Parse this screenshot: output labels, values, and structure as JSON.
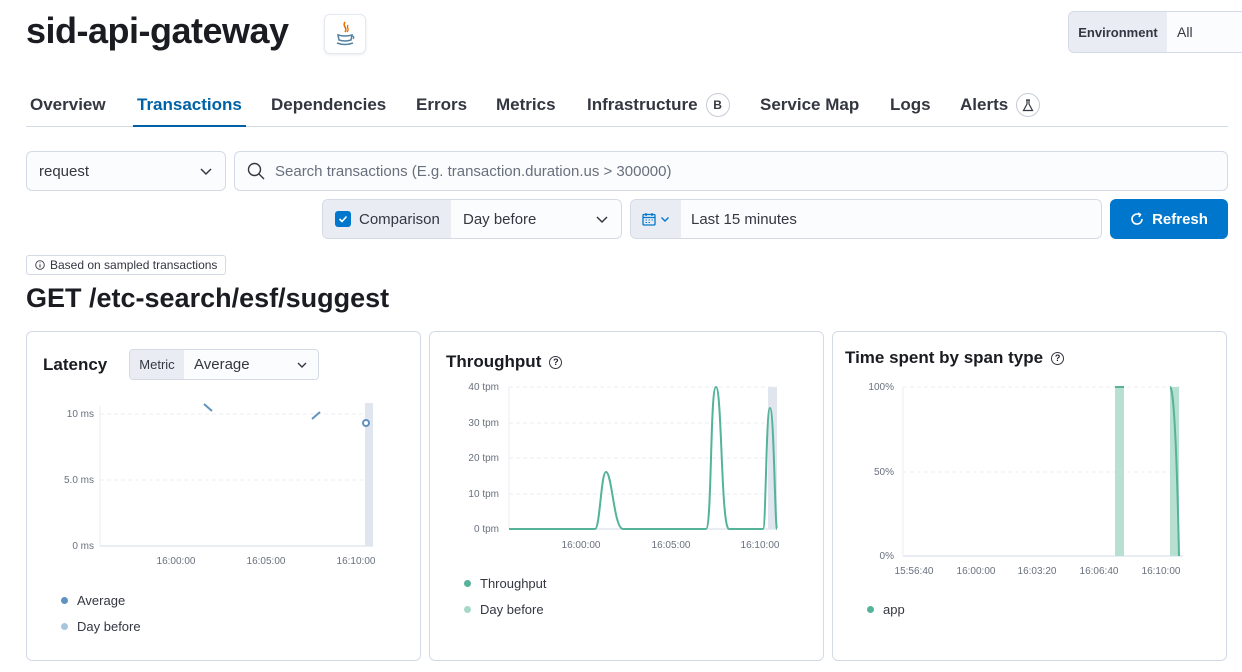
{
  "header": {
    "service_name": "sid-api-gateway",
    "agent_icon": "java-icon",
    "environment_label": "Environment",
    "environment_value": "All"
  },
  "tabs": [
    {
      "label": "Overview",
      "active": false
    },
    {
      "label": "Transactions",
      "active": true
    },
    {
      "label": "Dependencies",
      "active": false
    },
    {
      "label": "Errors",
      "active": false
    },
    {
      "label": "Metrics",
      "active": false
    },
    {
      "label": "Infrastructure",
      "active": false,
      "badge": "B"
    },
    {
      "label": "Service Map",
      "active": false
    },
    {
      "label": "Logs",
      "active": false
    },
    {
      "label": "Alerts",
      "active": false,
      "badge_icon": "flask-icon"
    }
  ],
  "filters": {
    "transaction_type": "request",
    "search_placeholder": "Search transactions (E.g. transaction.duration.us > 300000)",
    "comparison_label": "Comparison",
    "comparison_checked": true,
    "comparison_value": "Day before",
    "date_range": "Last 15 minutes",
    "refresh_label": "Refresh"
  },
  "sampled_badge": "Based on sampled transactions",
  "transaction_name": "GET /etc-search/esf/suggest",
  "colors": {
    "accent": "#0077cc",
    "latency_avg": "#6092c0",
    "latency_daybefore": "#a8c5e0",
    "throughput": "#54b399",
    "throughput_daybefore": "#a6d8c6",
    "app": "#54b399"
  },
  "panels": {
    "latency": {
      "title": "Latency",
      "metric_label": "Metric",
      "metric_value": "Average",
      "legend": [
        "Average",
        "Day before"
      ]
    },
    "throughput": {
      "title": "Throughput",
      "legend": [
        "Throughput",
        "Day before"
      ]
    },
    "span_type": {
      "title": "Time spent by span type",
      "legend": [
        "app"
      ]
    }
  },
  "chart_data": [
    {
      "type": "line",
      "title": "Latency",
      "y_ticks": [
        "0 ms",
        "5.0 ms",
        "10 ms"
      ],
      "x_ticks": [
        "16:00:00",
        "16:05:00",
        "16:10:00"
      ],
      "ylim": [
        0,
        12
      ],
      "series": [
        {
          "name": "Average",
          "segments": [
            [
              [
                "15:57:45",
                10.6
              ],
              [
                "15:58:15",
                10.1
              ]
            ],
            [
              [
                "16:07:15",
                9.9
              ],
              [
                "16:07:45",
                10.5
              ]
            ]
          ],
          "point": [
            "16:10:30",
            9.2
          ]
        }
      ]
    },
    {
      "type": "area",
      "title": "Throughput",
      "y_ticks": [
        "0 tpm",
        "10 tpm",
        "20 tpm",
        "30 tpm",
        "40 tpm"
      ],
      "x_ticks": [
        "16:00:00",
        "16:05:00",
        "16:10:00"
      ],
      "ylim": [
        0,
        40
      ],
      "series": [
        {
          "name": "Throughput",
          "x": [
            "15:56:00",
            "15:57:30",
            "15:58:00",
            "15:58:30",
            "16:03:00",
            "16:03:30",
            "16:04:00",
            "16:04:30",
            "16:05:00",
            "16:05:30",
            "16:06:00",
            "16:06:20"
          ],
          "values": [
            0,
            0,
            16,
            0,
            0,
            0,
            40,
            0,
            0,
            0,
            34,
            0
          ]
        }
      ]
    },
    {
      "type": "area",
      "title": "Time spent by span type",
      "y_ticks": [
        "0%",
        "50%",
        "100%"
      ],
      "x_ticks": [
        "15:56:40",
        "16:00:00",
        "16:03:20",
        "16:06:40",
        "16:10:00"
      ],
      "ylim": [
        0,
        100
      ],
      "series": [
        {
          "name": "app",
          "bands": [
            [
              "16:07:20",
              "16:07:50"
            ],
            [
              "16:10:20",
              "16:10:50"
            ]
          ],
          "values_pct": [
            100,
            100
          ]
        }
      ]
    }
  ]
}
